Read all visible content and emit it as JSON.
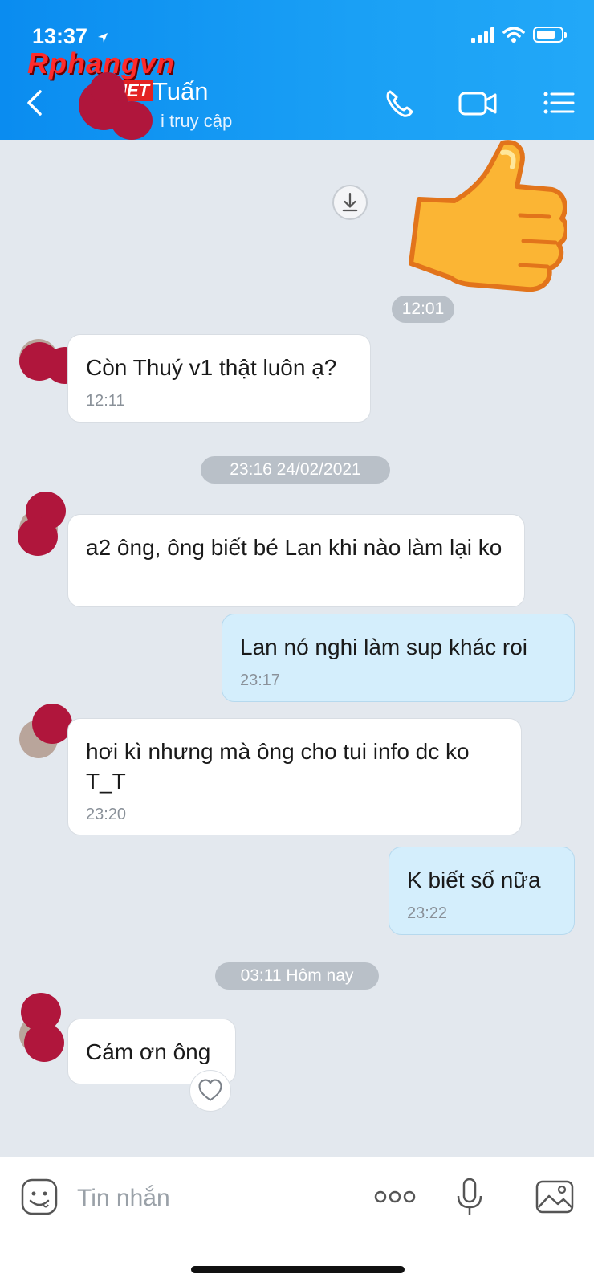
{
  "status_bar": {
    "time": "13:37"
  },
  "watermark": {
    "main": "Rphangvn",
    "suffix": ".NET"
  },
  "header": {
    "contact_name": "Tuấn",
    "contact_status": "i truy cập"
  },
  "chat": {
    "time_dividers": [
      "12:01",
      "23:16 24/02/2021",
      "03:11 Hôm nay"
    ],
    "messages": [
      {
        "from": "them",
        "text": "Còn Thuý v1 thật luôn ạ?",
        "time": "12:11"
      },
      {
        "from": "them",
        "text": "a2 ông, ông biết bé Lan khi nào làm lại ko",
        "time": ""
      },
      {
        "from": "me",
        "text": "Lan nó nghi làm sup khác roi",
        "time": "23:17"
      },
      {
        "from": "them",
        "text": "hơi kì nhưng mà ông cho tui info dc ko T_T",
        "time": "23:20"
      },
      {
        "from": "me",
        "text": "K biết số nữa",
        "time": "23:22"
      },
      {
        "from": "them",
        "text": "Cám ơn ông",
        "time": ""
      }
    ]
  },
  "composer": {
    "placeholder": "Tin nhắn"
  },
  "colors": {
    "header": "#1a9cf5",
    "my_bubble": "#d4eefc",
    "background": "#e3e8ee"
  }
}
